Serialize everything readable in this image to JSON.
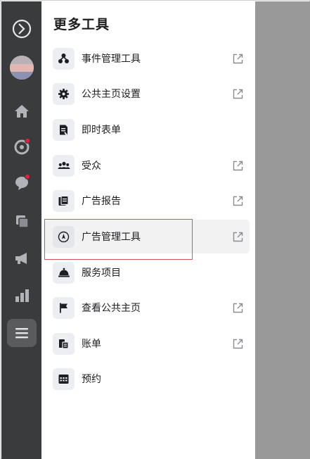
{
  "panel": {
    "title": "更多工具"
  },
  "rail": {
    "items": [
      {
        "name": "logo",
        "icon": "circle-chevron-logo-icon"
      },
      {
        "name": "avatar",
        "icon": "avatar"
      },
      {
        "name": "home",
        "icon": "home-icon"
      },
      {
        "name": "notifications",
        "icon": "activity-icon",
        "badge": true
      },
      {
        "name": "messages",
        "icon": "chat-bubble-icon",
        "badge": true
      },
      {
        "name": "pages",
        "icon": "pages-icon"
      },
      {
        "name": "ads",
        "icon": "megaphone-icon"
      },
      {
        "name": "insights",
        "icon": "bar-chart-icon"
      },
      {
        "name": "more-tools",
        "icon": "hamburger-menu-icon",
        "active": true
      }
    ]
  },
  "menu": [
    {
      "label": "事件管理工具",
      "icon": "event-manager-icon",
      "external": true
    },
    {
      "label": "公共主页设置",
      "icon": "settings-gear-icon",
      "external": true
    },
    {
      "label": "即时表单",
      "icon": "instant-form-icon",
      "external": false
    },
    {
      "label": "受众",
      "icon": "audience-icon",
      "external": true
    },
    {
      "label": "广告报告",
      "icon": "ad-reports-icon",
      "external": true
    },
    {
      "label": "广告管理工具",
      "icon": "ads-manager-icon",
      "external": true,
      "hovered": true
    },
    {
      "label": "服务项目",
      "icon": "services-bell-icon",
      "external": false
    },
    {
      "label": "查看公共主页",
      "icon": "flag-icon",
      "external": true
    },
    {
      "label": "账单",
      "icon": "billing-icon",
      "external": true
    },
    {
      "label": "预约",
      "icon": "calendar-icon",
      "external": false
    }
  ],
  "colors": {
    "rail_bg": "#3a3b3c",
    "rail_icon": "#b0b3b8",
    "badge": "#e41e3f",
    "highlight_border": "#d9534f",
    "scrim": "#999999"
  }
}
